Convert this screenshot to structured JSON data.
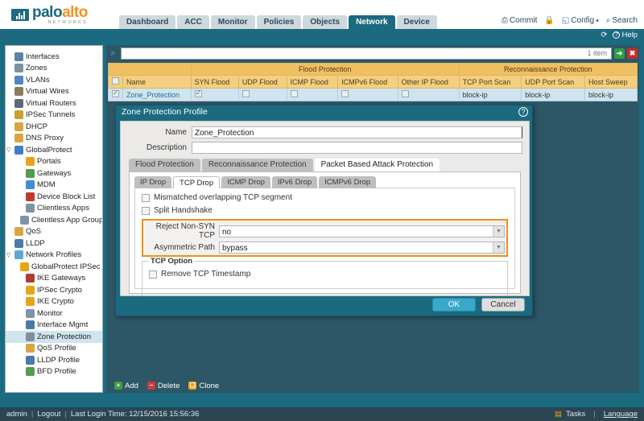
{
  "brand": {
    "name_part1": "palo",
    "name_part2": "alto",
    "sub": "NETWORKS"
  },
  "header": {
    "tabs": [
      {
        "label": "Dashboard",
        "active": false
      },
      {
        "label": "ACC",
        "active": false
      },
      {
        "label": "Monitor",
        "active": false
      },
      {
        "label": "Policies",
        "active": false
      },
      {
        "label": "Objects",
        "active": false
      },
      {
        "label": "Network",
        "active": true
      },
      {
        "label": "Device",
        "active": false
      }
    ],
    "links": [
      {
        "label": "Commit",
        "icon": "commit-icon"
      },
      {
        "label": "",
        "icon": "lock-icon"
      },
      {
        "label": "Config",
        "icon": "config-icon",
        "caret": "▾"
      },
      {
        "label": "Search",
        "icon": "search-icon"
      }
    ],
    "subbar": [
      {
        "label": "",
        "icon": "refresh-icon",
        "glyph": "⟳"
      },
      {
        "label": "Help",
        "icon": "help-icon",
        "glyph": "?"
      }
    ]
  },
  "sidebar": {
    "items": [
      {
        "label": "Interfaces",
        "icon": "interfaces-icon",
        "color": "#5b83a8",
        "level": 0,
        "twist": "",
        "selected": false
      },
      {
        "label": "Zones",
        "icon": "zones-icon",
        "color": "#7d8fa3",
        "level": 0,
        "twist": "",
        "selected": false
      },
      {
        "label": "VLANs",
        "icon": "vlans-icon",
        "color": "#4f86c6",
        "level": 0,
        "twist": "",
        "selected": false
      },
      {
        "label": "Virtual Wires",
        "icon": "virtual-wires-icon",
        "color": "#8a7b5c",
        "level": 0,
        "twist": "",
        "selected": false
      },
      {
        "label": "Virtual Routers",
        "icon": "virtual-routers-icon",
        "color": "#5a6a78",
        "level": 0,
        "twist": "",
        "selected": false
      },
      {
        "label": "IPSec Tunnels",
        "icon": "ipsec-tunnels-icon",
        "color": "#c9a227",
        "level": 0,
        "twist": "",
        "selected": false
      },
      {
        "label": "DHCP",
        "icon": "dhcp-icon",
        "color": "#d9a441",
        "level": 0,
        "twist": "",
        "selected": false
      },
      {
        "label": "DNS Proxy",
        "icon": "dns-proxy-icon",
        "color": "#d9a441",
        "level": 0,
        "twist": "",
        "selected": false
      },
      {
        "label": "GlobalProtect",
        "icon": "globalprotect-icon",
        "color": "#3f7fbf",
        "level": 0,
        "twist": "▽",
        "selected": false
      },
      {
        "label": "Portals",
        "icon": "portals-icon",
        "color": "#e8a317",
        "level": 1,
        "twist": "",
        "selected": false
      },
      {
        "label": "Gateways",
        "icon": "gateways-icon",
        "color": "#4f9e4f",
        "level": 1,
        "twist": "",
        "selected": false
      },
      {
        "label": "MDM",
        "icon": "mdm-icon",
        "color": "#3f8fcf",
        "level": 1,
        "twist": "",
        "selected": false
      },
      {
        "label": "Device Block List",
        "icon": "device-block-list-icon",
        "color": "#c0392b",
        "level": 1,
        "twist": "",
        "selected": false
      },
      {
        "label": "Clientless Apps",
        "icon": "clientless-apps-icon",
        "color": "#7f93a8",
        "level": 1,
        "twist": "",
        "selected": false
      },
      {
        "label": "Clientless App Groups",
        "icon": "clientless-app-groups-icon",
        "color": "#7f93a8",
        "level": 1,
        "twist": "",
        "selected": false
      },
      {
        "label": "QoS",
        "icon": "qos-icon",
        "color": "#d9a441",
        "level": 0,
        "twist": "",
        "selected": false
      },
      {
        "label": "LLDP",
        "icon": "lldp-icon",
        "color": "#4a7aa8",
        "level": 0,
        "twist": "",
        "selected": false
      },
      {
        "label": "Network Profiles",
        "icon": "network-profiles-icon",
        "color": "#5fa8d3",
        "level": 0,
        "twist": "▽",
        "selected": false
      },
      {
        "label": "GlobalProtect IPSec Crypto",
        "icon": "gp-ipsec-crypto-icon",
        "color": "#e8a317",
        "level": 1,
        "twist": "",
        "selected": false
      },
      {
        "label": "IKE Gateways",
        "icon": "ike-gateways-icon",
        "color": "#b03a2e",
        "level": 1,
        "twist": "",
        "selected": false
      },
      {
        "label": "IPSec Crypto",
        "icon": "ipsec-crypto-icon",
        "color": "#e8a317",
        "level": 1,
        "twist": "",
        "selected": false
      },
      {
        "label": "IKE Crypto",
        "icon": "ike-crypto-icon",
        "color": "#e8a317",
        "level": 1,
        "twist": "",
        "selected": false
      },
      {
        "label": "Monitor",
        "icon": "monitor-icon",
        "color": "#7f93a8",
        "level": 1,
        "twist": "",
        "selected": false
      },
      {
        "label": "Interface Mgmt",
        "icon": "interface-mgmt-icon",
        "color": "#4a7aa8",
        "level": 1,
        "twist": "",
        "selected": false
      },
      {
        "label": "Zone Protection",
        "icon": "zone-protection-icon",
        "color": "#7d8fa3",
        "level": 1,
        "twist": "",
        "selected": true
      },
      {
        "label": "QoS Profile",
        "icon": "qos-profile-icon",
        "color": "#d9a441",
        "level": 1,
        "twist": "",
        "selected": false
      },
      {
        "label": "LLDP Profile",
        "icon": "lldp-profile-icon",
        "color": "#4a7aa8",
        "level": 1,
        "twist": "",
        "selected": false
      },
      {
        "label": "BFD Profile",
        "icon": "bfd-profile-icon",
        "color": "#4f9e4f",
        "level": 1,
        "twist": "",
        "selected": false
      }
    ]
  },
  "search": {
    "value": "",
    "placeholder": "",
    "item_count": "1 item",
    "go_glyph": "➜",
    "clear_glyph": "✖"
  },
  "grid": {
    "groups": [
      {
        "label": "",
        "span": 2
      },
      {
        "label": "Flood Protection",
        "span": 5
      },
      {
        "label": "Reconnaissance Protection",
        "span": 3
      }
    ],
    "columns": [
      "",
      "Name",
      "SYN Flood",
      "UDP Flood",
      "ICMP Flood",
      "ICMPv6 Flood",
      "Other IP Flood",
      "TCP Port Scan",
      "UDP Port Scan",
      "Host Sweep"
    ],
    "rows": [
      {
        "selected_checkbox": true,
        "name": "Zone_Protection",
        "syn_flood": true,
        "udp_flood": false,
        "icmp_flood": false,
        "icmpv6_flood": false,
        "other_ip_flood": false,
        "tcp_port_scan": "block-ip",
        "udp_port_scan": "block-ip",
        "host_sweep": "block-ip"
      }
    ]
  },
  "toolbar": {
    "add_label": "Add",
    "add_glyph": "+",
    "delete_label": "Delete",
    "delete_glyph": "−",
    "clone_label": "Clone",
    "clone_glyph": "❏"
  },
  "dialog": {
    "title": "Zone Protection Profile",
    "help_glyph": "?",
    "name_label": "Name",
    "name_value": "Zone_Protection",
    "description_label": "Description",
    "description_value": "",
    "outer_tabs": [
      {
        "label": "Flood Protection",
        "active": false
      },
      {
        "label": "Reconnaissance Protection",
        "active": false
      },
      {
        "label": "Packet Based Attack Protection",
        "active": true
      }
    ],
    "inner_tabs": [
      {
        "label": "IP Drop",
        "active": false
      },
      {
        "label": "TCP Drop",
        "active": true
      },
      {
        "label": "ICMP Drop",
        "active": false
      },
      {
        "label": "IPv6 Drop",
        "active": false
      },
      {
        "label": "ICMPv6 Drop",
        "active": false
      }
    ],
    "checkboxes": [
      {
        "label": "Mismatched overlapping TCP segment",
        "checked": false
      },
      {
        "label": "Split Handshake",
        "checked": false
      }
    ],
    "highlighted_selects": [
      {
        "label": "Reject Non-SYN TCP",
        "value": "no",
        "arrow": "▼"
      },
      {
        "label": "Asymmetric Path",
        "value": "bypass",
        "arrow": "▼"
      }
    ],
    "fieldset_legend": "TCP Option",
    "fieldset_checkboxes": [
      {
        "label": "Remove TCP Timestamp",
        "checked": false
      }
    ],
    "ok_label": "OK",
    "cancel_label": "Cancel",
    "highlight_color": "#ef8f1c"
  },
  "statusbar": {
    "user": "admin",
    "logout": "Logout",
    "last_login": "Last Login Time: 12/15/2016 15:56:36",
    "tasks": "Tasks",
    "language": "Language"
  }
}
